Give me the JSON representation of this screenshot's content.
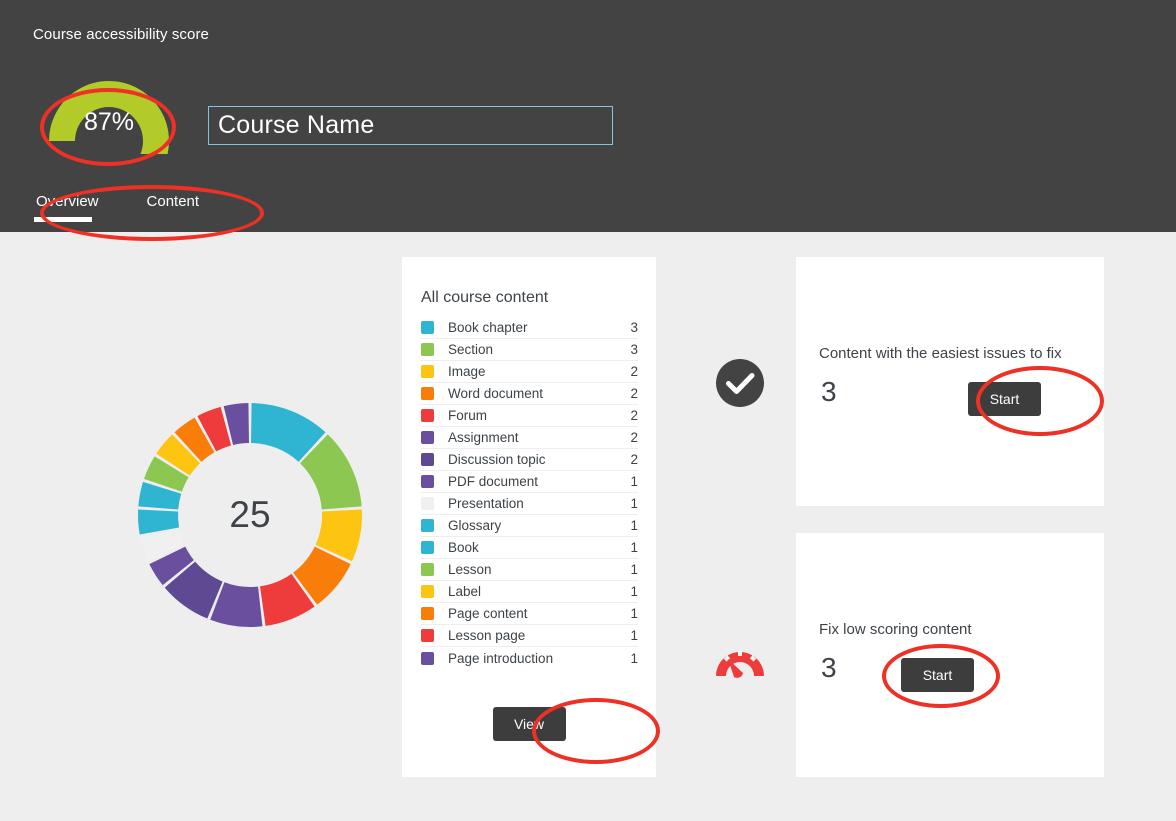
{
  "header": {
    "title": "Course accessibility score",
    "score_label": "87%",
    "score_value": 87,
    "gauge_color": "#b3cb29",
    "background_color": "#434343",
    "course_name": {
      "value": "Course Name",
      "placeholder": "Course Name"
    },
    "tabs": [
      {
        "label": "Overview",
        "active": true
      },
      {
        "label": "Content",
        "active": false
      }
    ]
  },
  "legend_card": {
    "title": "All course content",
    "total": "25",
    "view_button": "View",
    "items": [
      {
        "label": "Book chapter",
        "count": "3",
        "value": 3,
        "color": "#2fb5d2"
      },
      {
        "label": "Section",
        "count": "3",
        "value": 3,
        "color": "#8cc751"
      },
      {
        "label": "Image",
        "count": "2",
        "value": 2,
        "color": "#fdc511"
      },
      {
        "label": "Word document",
        "count": "2",
        "value": 2,
        "color": "#f97d09"
      },
      {
        "label": "Forum",
        "count": "2",
        "value": 2,
        "color": "#ee3b3b"
      },
      {
        "label": "Assignment",
        "count": "2",
        "value": 2,
        "color": "#6a4f9e"
      },
      {
        "label": "Discussion topic",
        "count": "2",
        "value": 2,
        "color": "#5d4a93"
      },
      {
        "label": "PDF document",
        "count": "1",
        "value": 1,
        "color": "#6a4f9e"
      },
      {
        "label": "Presentation",
        "count": "1",
        "value": 1,
        "color": "#f0f0f0"
      },
      {
        "label": "Glossary",
        "count": "1",
        "value": 1,
        "color": "#2fb5d2"
      },
      {
        "label": "Book",
        "count": "1",
        "value": 1,
        "color": "#2fb5d2"
      },
      {
        "label": "Lesson",
        "count": "1",
        "value": 1,
        "color": "#8cc751"
      },
      {
        "label": "Label",
        "count": "1",
        "value": 1,
        "color": "#fdc511"
      },
      {
        "label": "Page content",
        "count": "1",
        "value": 1,
        "color": "#f97d09"
      },
      {
        "label": "Lesson page",
        "count": "1",
        "value": 1,
        "color": "#ee3b3b"
      },
      {
        "label": "Page introduction",
        "count": "1",
        "value": 1,
        "color": "#6a4f9e"
      }
    ]
  },
  "tasks": [
    {
      "id": "easiest",
      "icon": "check-circle-icon",
      "icon_color": "#434343",
      "heading": "Content with the easiest issues to fix",
      "count": "3",
      "button": "Start"
    },
    {
      "id": "lowscore",
      "icon": "speedometer-icon",
      "icon_color": "#ee3b3b",
      "heading": "Fix low scoring content",
      "count": "3",
      "button": "Start"
    }
  ],
  "chart_data": {
    "type": "pie",
    "title": "All course content",
    "center_label": "25",
    "total": 25,
    "categories": [
      "Book chapter",
      "Section",
      "Image",
      "Word document",
      "Forum",
      "Assignment",
      "Discussion topic",
      "PDF document",
      "Presentation",
      "Glossary",
      "Book",
      "Lesson",
      "Label",
      "Page content",
      "Lesson page",
      "Page introduction"
    ],
    "values": [
      3,
      3,
      2,
      2,
      2,
      2,
      2,
      1,
      1,
      1,
      1,
      1,
      1,
      1,
      1,
      1
    ],
    "colors": [
      "#2fb5d2",
      "#8cc751",
      "#fdc511",
      "#f97d09",
      "#ee3b3b",
      "#6a4f9e",
      "#5d4a93",
      "#6a4f9e",
      "#f0f0f0",
      "#2fb5d2",
      "#2fb5d2",
      "#8cc751",
      "#fdc511",
      "#f97d09",
      "#ee3b3b",
      "#6a4f9e"
    ],
    "legend_position": "right",
    "donut": true,
    "start_angle": 0,
    "direction": "clockwise"
  },
  "annotations": {
    "color": "#ee3124",
    "shapes": [
      {
        "target": "score-gauge",
        "type": "ellipse"
      },
      {
        "target": "tabs",
        "type": "ellipse"
      },
      {
        "target": "view-button",
        "type": "ellipse"
      },
      {
        "target": "start-button-easiest",
        "type": "ellipse"
      },
      {
        "target": "start-button-lowscore",
        "type": "ellipse"
      }
    ]
  }
}
